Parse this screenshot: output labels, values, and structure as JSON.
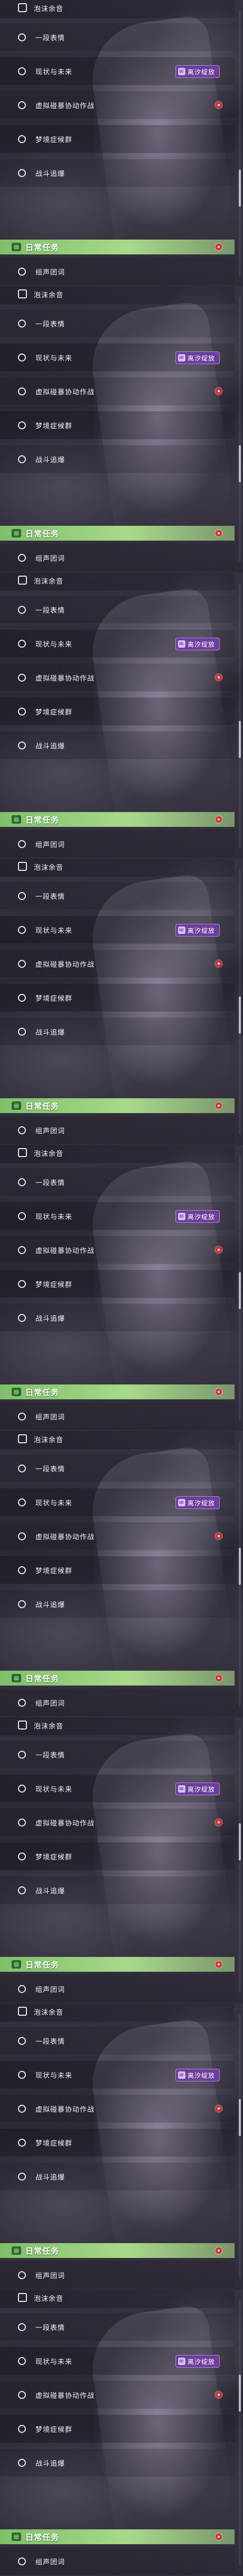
{
  "colors": {
    "accent_section": "#a8d98b",
    "tag_purple": "#6c3f9c",
    "notification_dot": "#d0333b"
  },
  "panels": [
    {
      "top_task": "泡沫余音",
      "tasks": [
        "一段表情",
        "现状与未来",
        "虚拟碰暴协动作战",
        "梦境症候群",
        "战斗追爆"
      ],
      "event_tag": "离汐绽放",
      "tag_icon": "envelope-icon",
      "section_title": "日常任务",
      "daily_task": "组声团词"
    },
    {
      "top_task": "泡沫余音",
      "tasks": [
        "一段表情",
        "现状与未来",
        "虚拟碰暴协动作战",
        "梦境症候群",
        "战斗追爆"
      ],
      "event_tag": "离汐绽放",
      "tag_icon": "envelope-icon",
      "section_title": "日常任务",
      "daily_task": "组声团词"
    },
    {
      "top_task": "泡沫余音",
      "tasks": [
        "一段表情",
        "现状与未来",
        "虚拟碰暴协动作战",
        "梦境症候群",
        "战斗追爆"
      ],
      "event_tag": "离汐绽放",
      "tag_icon": "envelope-icon",
      "section_title": "日常任务",
      "daily_task": "组声团词"
    },
    {
      "top_task": "泡沫余音",
      "tasks": [
        "一段表情",
        "现状与未来",
        "虚拟碰暴协动作战",
        "梦境症候群",
        "战斗追爆"
      ],
      "event_tag": "离汐绽放",
      "tag_icon": "envelope-icon",
      "section_title": "日常任务",
      "daily_task": "组声团词"
    },
    {
      "top_task": "泡沫余音",
      "tasks": [
        "一段表情",
        "现状与未来",
        "虚拟碰暴协动作战",
        "梦境症候群",
        "战斗追爆"
      ],
      "event_tag": "离汐绽放",
      "tag_icon": "envelope-icon",
      "section_title": "日常任务",
      "daily_task": "组声团词"
    },
    {
      "top_task": "泡沫余音",
      "tasks": [
        "一段表情",
        "现状与未来",
        "虚拟碰暴协动作战",
        "梦境症候群",
        "战斗追爆"
      ],
      "event_tag": "离汐绽放",
      "tag_icon": "envelope-icon",
      "section_title": "日常任务",
      "daily_task": "组声团词"
    },
    {
      "top_task": "泡沫余音",
      "tasks": [
        "一段表情",
        "现状与未来",
        "虚拟碰暴协动作战",
        "梦境症候群",
        "战斗追爆"
      ],
      "event_tag": "离汐绽放",
      "tag_icon": "envelope-icon",
      "section_title": "日常任务",
      "daily_task": "组声团词"
    },
    {
      "top_task": "泡沫余音",
      "tasks": [
        "一段表情",
        "现状与未来",
        "虚拟碰暴协动作战",
        "梦境症候群",
        "战斗追爆"
      ],
      "event_tag": "离汐绽放",
      "tag_icon": "envelope-icon",
      "section_title": "日常任务",
      "daily_task": "组声团词"
    },
    {
      "top_task": "泡沫余音",
      "tasks": [
        "一段表情",
        "现状与未来",
        "虚拟碰暴协动作战",
        "梦境症候群",
        "战斗追爆"
      ],
      "event_tag": "离汐绽放",
      "tag_icon": "envelope-icon",
      "section_title": "日常任务",
      "daily_task": "组声团词"
    }
  ]
}
